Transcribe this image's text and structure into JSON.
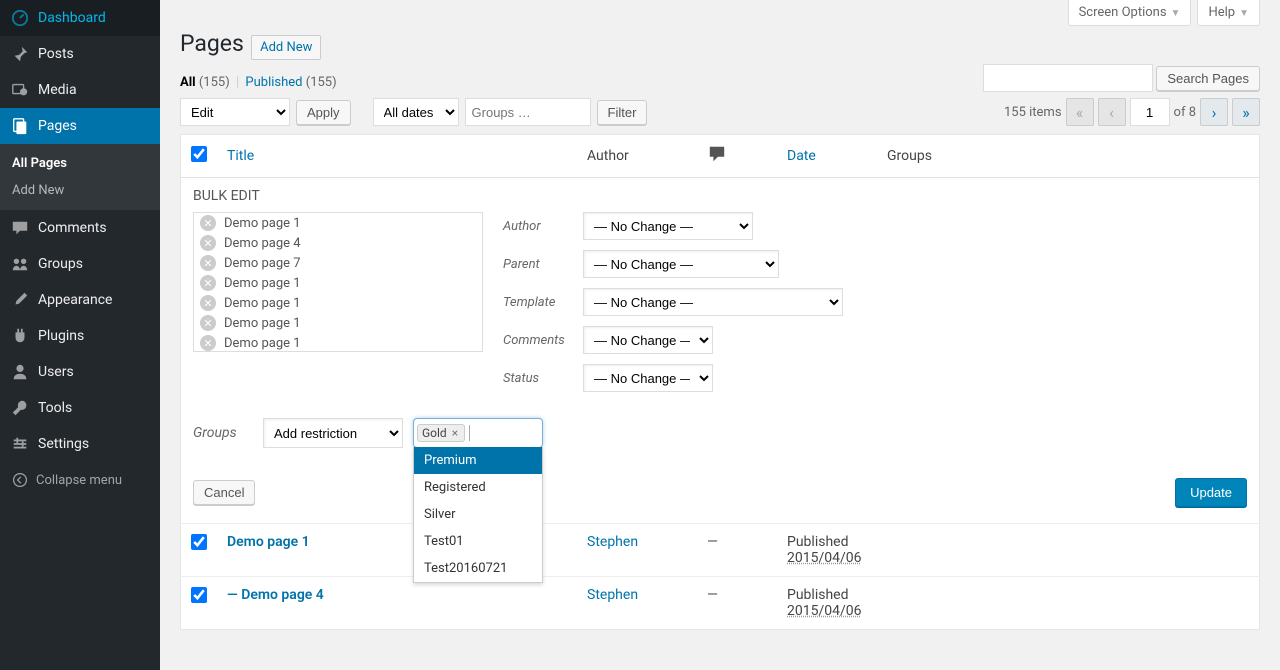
{
  "sidebar": {
    "items": [
      {
        "label": "Dashboard",
        "icon": "dashboard"
      },
      {
        "label": "Posts",
        "icon": "pin"
      },
      {
        "label": "Media",
        "icon": "media"
      },
      {
        "label": "Pages",
        "icon": "pages",
        "current": true
      },
      {
        "label": "Comments",
        "icon": "comment"
      },
      {
        "label": "Groups",
        "icon": "groups"
      },
      {
        "label": "Appearance",
        "icon": "appearance"
      },
      {
        "label": "Plugins",
        "icon": "plugins"
      },
      {
        "label": "Users",
        "icon": "users"
      },
      {
        "label": "Tools",
        "icon": "tools"
      },
      {
        "label": "Settings",
        "icon": "settings"
      }
    ],
    "submenu": [
      {
        "label": "All Pages",
        "current": true
      },
      {
        "label": "Add New"
      }
    ],
    "collapse": "Collapse menu"
  },
  "top_tabs": {
    "screen_options": "Screen Options",
    "help": "Help"
  },
  "header": {
    "title": "Pages",
    "add_new": "Add New"
  },
  "filters": {
    "all_label": "All",
    "all_count": "(155)",
    "published_label": "Published",
    "published_count": "(155)"
  },
  "search": {
    "button": "Search Pages"
  },
  "tablenav": {
    "bulk_action": "Edit",
    "apply": "Apply",
    "date_filter": "All dates",
    "groups_placeholder": "Groups …",
    "filter": "Filter",
    "items_text": "155 items",
    "page_current": "1",
    "page_of": "of 8"
  },
  "columns": {
    "title": "Title",
    "author": "Author",
    "date": "Date",
    "groups": "Groups"
  },
  "bulk_edit": {
    "heading": "BULK EDIT",
    "selected_pages": [
      "Demo page 1",
      "Demo page 4",
      "Demo page 7",
      "Demo page 1",
      "Demo page 1",
      "Demo page 1",
      "Demo page 1"
    ],
    "fields": {
      "author_label": "Author",
      "author_value": "— No Change —",
      "parent_label": "Parent",
      "parent_value": "— No Change —",
      "template_label": "Template",
      "template_value": "— No Change —",
      "comments_label": "Comments",
      "comments_value": "— No Change —",
      "status_label": "Status",
      "status_value": "— No Change —"
    },
    "groups_label": "Groups",
    "groups_action": "Add restriction",
    "token": "Gold",
    "dropdown_options": [
      "Premium",
      "Registered",
      "Silver",
      "Test01",
      "Test20160721"
    ],
    "cancel": "Cancel",
    "update": "Update"
  },
  "rows": [
    {
      "checked": true,
      "title": "Demo page 1",
      "author": "Stephen",
      "comments": "—",
      "status": "Published",
      "date": "2015/04/06"
    },
    {
      "checked": true,
      "title": "— Demo page 4",
      "author": "Stephen",
      "comments": "—",
      "status": "Published",
      "date": "2015/04/06"
    }
  ]
}
